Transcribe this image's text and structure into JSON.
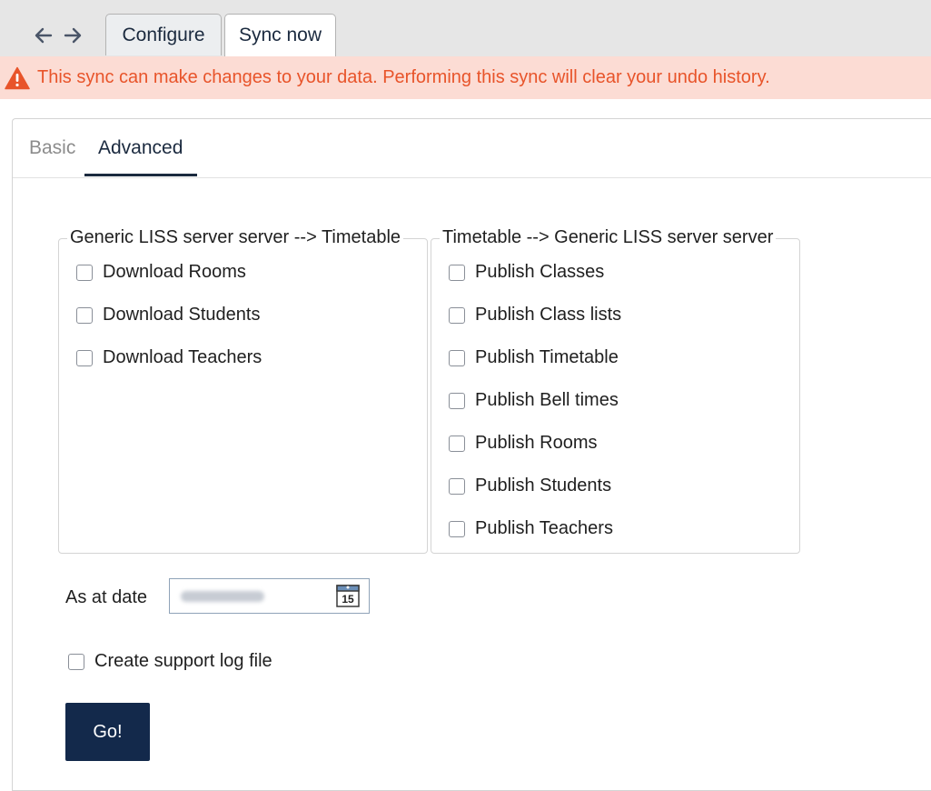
{
  "nav": {
    "back_icon": "arrow-left-icon",
    "forward_icon": "arrow-right-icon"
  },
  "tabs": [
    {
      "label": "Configure",
      "active": false
    },
    {
      "label": "Sync now",
      "active": true
    }
  ],
  "warning": {
    "icon": "warning-triangle-icon",
    "text": "This sync can make changes to your data. Performing this sync will clear your undo history.",
    "color": "#e8542a",
    "background": "#fcdcd4"
  },
  "subtabs": [
    {
      "label": "Basic",
      "active": false
    },
    {
      "label": "Advanced",
      "active": true
    }
  ],
  "download_group": {
    "legend": "Generic LISS server server --> Timetable",
    "items": [
      {
        "label": "Download Rooms",
        "checked": false
      },
      {
        "label": "Download Students",
        "checked": false
      },
      {
        "label": "Download Teachers",
        "checked": false
      }
    ]
  },
  "publish_group": {
    "legend": "Timetable --> Generic LISS server server",
    "items": [
      {
        "label": "Publish Classes",
        "checked": false
      },
      {
        "label": "Publish Class lists",
        "checked": false
      },
      {
        "label": "Publish Timetable",
        "checked": false
      },
      {
        "label": "Publish Bell times",
        "checked": false
      },
      {
        "label": "Publish Rooms",
        "checked": false
      },
      {
        "label": "Publish Students",
        "checked": false
      },
      {
        "label": "Publish Teachers",
        "checked": false
      }
    ]
  },
  "date": {
    "label": "As at date",
    "value": "",
    "calendar_icon": "calendar-icon",
    "calendar_day": "15"
  },
  "support_log": {
    "label": "Create support log file",
    "checked": false
  },
  "go_button": {
    "label": "Go!",
    "color": "#13294b"
  }
}
